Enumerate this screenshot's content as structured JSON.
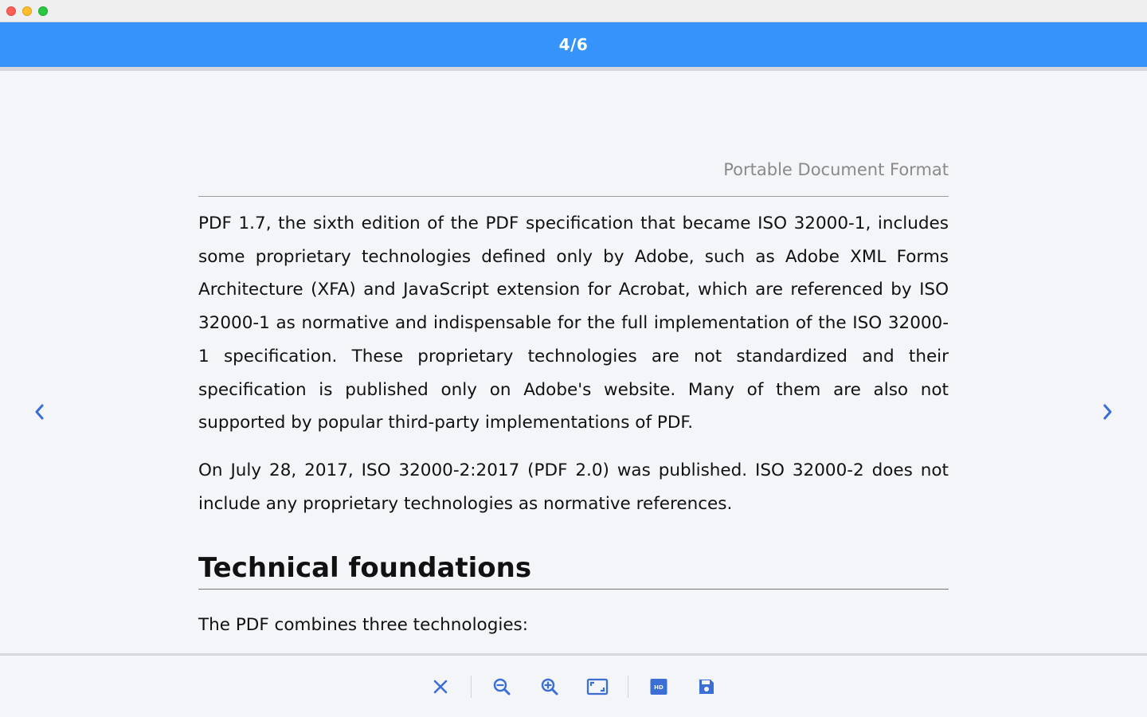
{
  "window": {
    "controls": [
      "close",
      "minimize",
      "zoom"
    ]
  },
  "header": {
    "page_counter": "4/6",
    "accent_color": "#3693fa"
  },
  "navigation": {
    "prev_icon": "chevron-left-icon",
    "next_icon": "chevron-right-icon"
  },
  "document": {
    "running_header": "Portable Document Format",
    "paragraphs": [
      "PDF 1.7, the sixth edition of the PDF specification that became ISO 32000-1, includes some proprietary technologies defined only by Adobe, such as Adobe XML Forms Architecture (XFA) and JavaScript extension for Acrobat, which are referenced by ISO 32000-1 as normative and indispensable for the full implementation of the ISO 32000-1 specification. These proprietary technologies are not standardized and their specification is published only on Adobe's website. Many of them are also not supported by popular third-party implementations of PDF.",
      "On July 28, 2017, ISO 32000-2:2017 (PDF 2.0) was published. ISO 32000-2 does not include any proprietary technologies as normative references.",
      "The PDF combines three technologies:"
    ],
    "section_heading": "Technical foundations"
  },
  "toolbar": {
    "icon_color": "#3b6fd4",
    "items": [
      "close-icon",
      "zoom-out-icon",
      "zoom-in-icon",
      "fit-page-icon",
      "hd-icon",
      "save-icon"
    ]
  }
}
